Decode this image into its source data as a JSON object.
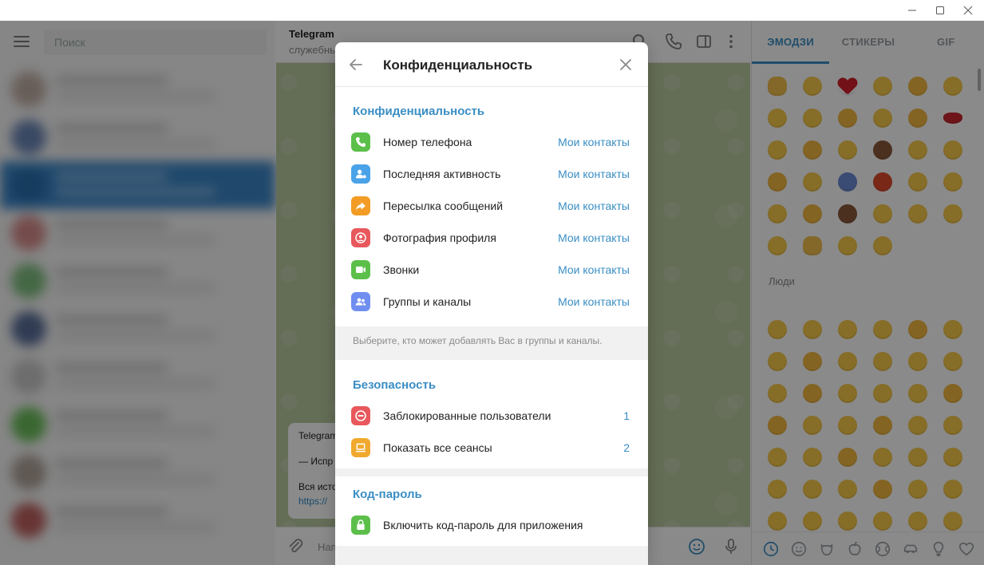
{
  "window": {
    "minimize_icon": "minimize-icon",
    "maximize_icon": "maximize-icon",
    "close_icon": "close-icon"
  },
  "left_panel": {
    "search_placeholder": "Поиск"
  },
  "chat": {
    "title": "Telegram",
    "subtitle": "служебные",
    "message_lines": [
      "Telegram",
      "— Испр",
      "Вся исто",
      "https://"
    ],
    "composer_placeholder": "Напи"
  },
  "emoji_panel": {
    "tabs": [
      "ЭМОДЗИ",
      "СТИКЕРЫ",
      "GIF"
    ],
    "active_tab": "ЭМОДЗИ",
    "section_people": "Люди"
  },
  "dialog": {
    "title": "Конфиденциальность",
    "privacy_section": "Конфиденциальность",
    "privacy_items": [
      {
        "label": "Номер телефона",
        "value": "Мои контакты",
        "icon": "phone-icon",
        "color": "#5bbf4a"
      },
      {
        "label": "Последняя активность",
        "value": "Мои контакты",
        "icon": "user-status-icon",
        "color": "#4aa3e8"
      },
      {
        "label": "Пересылка сообщений",
        "value": "Мои контакты",
        "icon": "forward-icon",
        "color": "#f29c26"
      },
      {
        "label": "Фотография профиля",
        "value": "Мои контакты",
        "icon": "profile-photo-icon",
        "color": "#e8585c"
      },
      {
        "label": "Звонки",
        "value": "Мои контакты",
        "icon": "video-call-icon",
        "color": "#5bbf4a"
      },
      {
        "label": "Группы и каналы",
        "value": "Мои контакты",
        "icon": "groups-icon",
        "color": "#6f8ef0"
      }
    ],
    "privacy_hint": "Выберите, кто может добавлять Вас в группы и каналы.",
    "security_section": "Безопасность",
    "security_items": [
      {
        "label": "Заблокированные пользователи",
        "value": "1",
        "icon": "block-icon",
        "color": "#e8585c"
      },
      {
        "label": "Показать все сеансы",
        "value": "2",
        "icon": "laptop-icon",
        "color": "#f0a92e"
      }
    ],
    "passcode_section": "Код-пароль",
    "passcode_items": [
      {
        "label": "Включить код-пароль для приложения",
        "icon": "lock-icon",
        "color": "#5bbf4a"
      }
    ]
  },
  "colors": {
    "accent": "#3a8ec4",
    "chat_bg": "#b9c9a0"
  }
}
